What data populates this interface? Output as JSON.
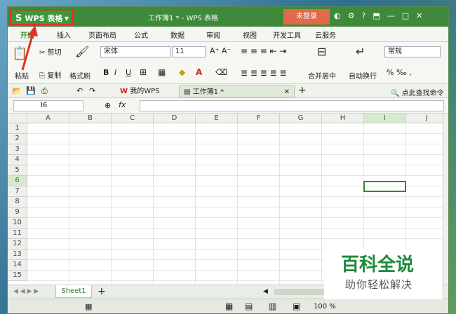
{
  "app": {
    "button_label": "WPS 表格",
    "window_title": "工作簿1 * - WPS 表格",
    "login_label": "未登录"
  },
  "ribbon_tabs": [
    "开始",
    "插入",
    "页面布局",
    "公式",
    "数据",
    "审阅",
    "视图",
    "开发工具",
    "云服务"
  ],
  "ribbon": {
    "paste": "粘贴",
    "cut": "剪切",
    "copy": "复制",
    "format_painter": "格式刷",
    "font_name": "宋体",
    "font_size": "11",
    "merge_center": "合并居中",
    "wrap_text": "自动换行",
    "number_format": "常规"
  },
  "doc_tabs": [
    {
      "label": "我的WPS"
    },
    {
      "label": "工作簿1 *"
    }
  ],
  "search_label": "点此查找命令",
  "formula_bar": {
    "name_box": "I6",
    "fx": "fx"
  },
  "columns": [
    "A",
    "B",
    "C",
    "D",
    "E",
    "F",
    "G",
    "H",
    "I",
    "J"
  ],
  "rows": [
    "1",
    "2",
    "3",
    "4",
    "5",
    "6",
    "7",
    "8",
    "9",
    "10",
    "11",
    "12",
    "13",
    "14",
    "15"
  ],
  "selected": {
    "col": "I",
    "row": "6"
  },
  "sheets": [
    "Sheet1"
  ],
  "status": {
    "zoom": "100 %"
  },
  "watermark": {
    "line1": "百科全说",
    "line2": "助你轻松解决"
  },
  "icons": [
    "s-logo-icon",
    "dropdown-arrow-icon",
    "skin-icon",
    "settings-icon",
    "help-icon",
    "minimize-icon",
    "maximize-icon",
    "close-icon",
    "cut-icon",
    "copy-icon",
    "brush-icon",
    "bold-icon",
    "italic-icon",
    "underline-icon",
    "border-icon",
    "fill-icon",
    "font-color-icon",
    "align-icon",
    "save-icon",
    "undo-icon",
    "redo-icon",
    "search-icon",
    "plus-icon",
    "red-arrow-icon"
  ],
  "colors": {
    "accent": "#3f8a3a",
    "login": "#e06a4a",
    "selection": "#2f8a2a",
    "highlight_border": "#e0302a"
  }
}
